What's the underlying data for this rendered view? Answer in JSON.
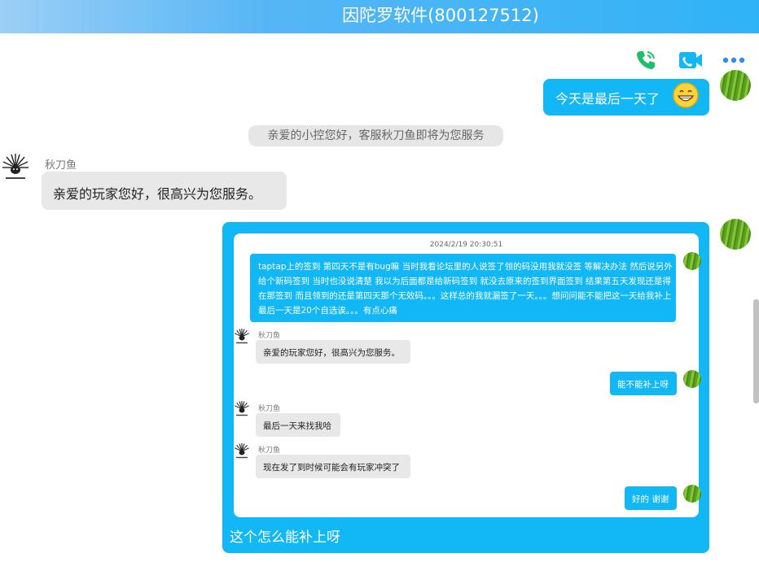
{
  "header": {
    "title": "因陀罗软件(800127512)"
  },
  "toolbar": {
    "call_icon": "phone-icon",
    "video_icon": "video-camera-icon",
    "more_icon": "more-dots-icon"
  },
  "chat": {
    "my_message_1": "今天是最后一天了",
    "emoji": "grin-emoji",
    "system_notice": "亲爱的小控您好，客服秋刀鱼即将为您服务",
    "agent_name": "秋刀鱼",
    "agent_message_1": "亲爱的玩家您好，很高兴为您服务。",
    "forwarded": {
      "timestamp": "2024/2/19 20:30:51",
      "messages": [
        {
          "from": "me",
          "text": "taptap上的签到 第四天不是有bug嘛 当时我看论坛里的人说签了领的码没用我就没签 等解决办法 然后说另外给个新码签到 当时也没说清楚 我以为后面都是给新码签到 就没去原来的签到界面签到 结果第五天发现还是得在那签到 而且领到的还是第四天那个无效码。。。这样总的我就漏签了一天。。。想问问能不能把这一天给我补上 最后一天是20个自选诶。。。有点心痛"
        },
        {
          "from": "agent",
          "name": "秋刀鱼",
          "text": "亲爱的玩家您好，很高兴为您服务。"
        },
        {
          "from": "me",
          "text": "能不能补上呀"
        },
        {
          "from": "agent",
          "name": "秋刀鱼",
          "text": "最后一天来找我哈"
        },
        {
          "from": "agent",
          "name": "秋刀鱼",
          "text": "现在发了到时候可能会有玩家冲突了"
        },
        {
          "from": "me",
          "text": "好的 谢谢"
        }
      ]
    },
    "my_message_2": "这个怎么能补上呀"
  },
  "colors": {
    "accent": "#12b7f5",
    "call_green": "#1fbf6a",
    "more_blue": "#2d8cf0"
  }
}
